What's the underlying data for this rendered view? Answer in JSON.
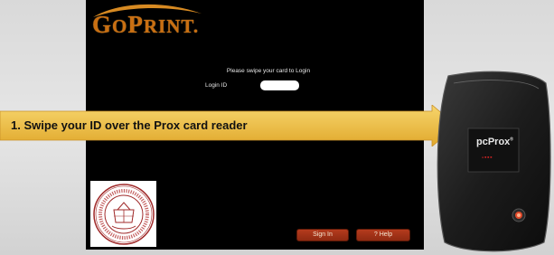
{
  "logo": {
    "brand": "GoPrint",
    "first": "G",
    "mid": "O",
    "print_first": "P",
    "print_rest": "RINT",
    "mark": ".",
    "color": "#c96f12"
  },
  "login": {
    "prompt": "Please swipe your card to Login",
    "id_label": "Login ID",
    "id_value": ""
  },
  "buttons": {
    "sign_in": "Sign In",
    "help": "? Help",
    "color": "#a3321a"
  },
  "callout": {
    "text": "1.  Swipe your ID over the Prox card reader",
    "color": "#f0c24a"
  },
  "reader": {
    "brand": "pcProx",
    "brand_mark": "®"
  }
}
